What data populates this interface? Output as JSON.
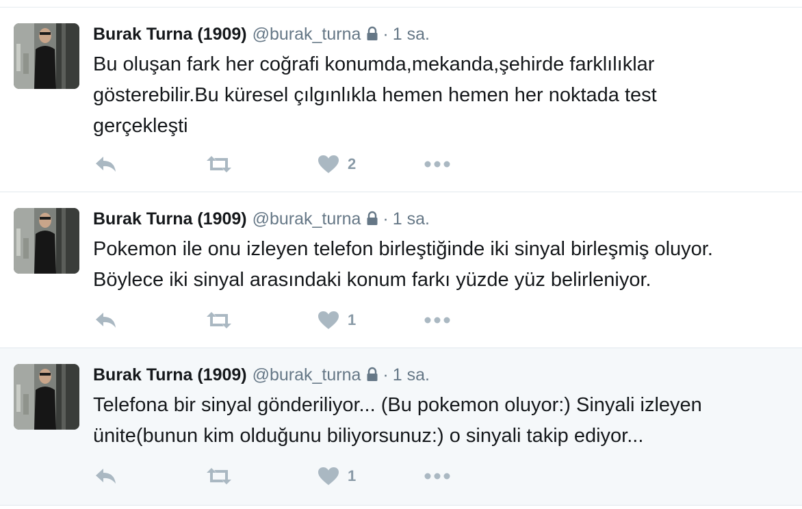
{
  "tweets": [
    {
      "fullname": "Burak Turna (1909)",
      "username": "@burak_turna",
      "separator": "·",
      "time": "1 sa.",
      "text_lines": [
        "Bu oluşan fark her coğrafi konumda,mekanda,şehirde farklılıklar",
        "gösterebilir.Bu küresel çılgınlıkla hemen hemen her noktada test",
        "gerçekleşti"
      ],
      "like_count": "2",
      "highlighted": false
    },
    {
      "fullname": "Burak Turna (1909)",
      "username": "@burak_turna",
      "separator": "·",
      "time": "1 sa.",
      "text_lines": [
        "Pokemon ile onu izleyen telefon birleştiğinde iki sinyal birleşmiş oluyor.",
        "Böylece iki sinyal arasındaki konum farkı yüzde yüz belirleniyor."
      ],
      "like_count": "1",
      "highlighted": false
    },
    {
      "fullname": "Burak Turna (1909)",
      "username": "@burak_turna",
      "separator": "·",
      "time": "1 sa.",
      "text_lines": [
        "Telefona bir sinyal gönderiliyor... (Bu pokemon oluyor:) Sinyali izleyen",
        "ünite(bunun kim olduğunu biliyorsunuz:) o sinyali takip ediyor..."
      ],
      "like_count": "1",
      "highlighted": true
    }
  ],
  "icons": {
    "reply": "reply-icon",
    "retweet": "retweet-icon",
    "like": "heart-icon",
    "more": "more-icon",
    "protected": "lock-icon"
  },
  "colors": {
    "text": "#14171a",
    "secondary": "#657786",
    "action_icon": "#aab8c2",
    "highlight_bg": "#f5f8fa",
    "border": "#e1e8ed"
  }
}
